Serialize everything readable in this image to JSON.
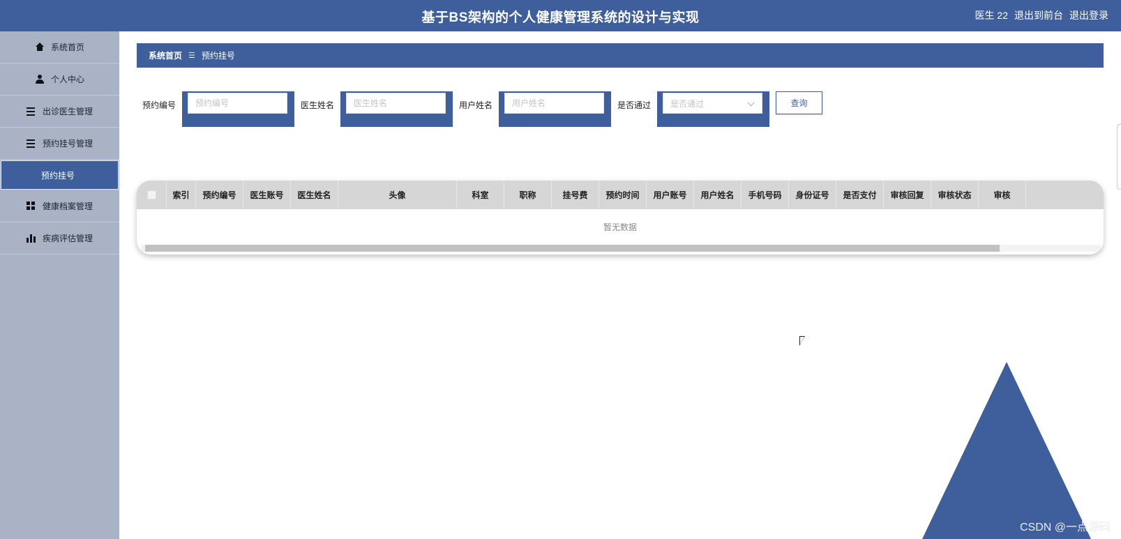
{
  "header": {
    "title": "基于BS架构的个人健康管理系统的设计与实现",
    "user": "医生 22",
    "to_front": "退出到前台",
    "logout": "退出登录"
  },
  "sidebar": {
    "items": [
      {
        "label": "系统首页",
        "icon": "home-icon"
      },
      {
        "label": "个人中心",
        "icon": "user-icon"
      },
      {
        "label": "出诊医生管理",
        "icon": "list-icon"
      },
      {
        "label": "预约挂号管理",
        "icon": "list-icon"
      },
      {
        "label": "预约挂号",
        "icon": "",
        "active": true
      },
      {
        "label": "健康档案管理",
        "icon": "grid-icon"
      },
      {
        "label": "疾病评估管理",
        "icon": "bar-chart-icon"
      }
    ]
  },
  "breadcrumb": {
    "home": "系统首页",
    "separator": "☰",
    "current": "预约挂号"
  },
  "search": {
    "fields": [
      {
        "label": "预约编号",
        "placeholder": "预约编号"
      },
      {
        "label": "医生姓名",
        "placeholder": "医生姓名"
      },
      {
        "label": "用户姓名",
        "placeholder": "用户姓名"
      },
      {
        "label": "是否通过",
        "placeholder": "是否通过"
      }
    ],
    "query_label": "查询"
  },
  "table": {
    "columns": [
      "索引",
      "预约编号",
      "医生账号",
      "医生姓名",
      "头像",
      "科室",
      "职称",
      "挂号费",
      "预约时间",
      "用户账号",
      "用户姓名",
      "手机号码",
      "身份证号",
      "是否支付",
      "审核回复",
      "审核状态",
      "审核"
    ],
    "empty_text": "暂无数据"
  },
  "watermark": "CSDN @一点源码",
  "colors": {
    "primary": "#3f5f9c",
    "sidebar_bg": "#aab3c5",
    "table_header_bg": "#d6d6d6"
  }
}
